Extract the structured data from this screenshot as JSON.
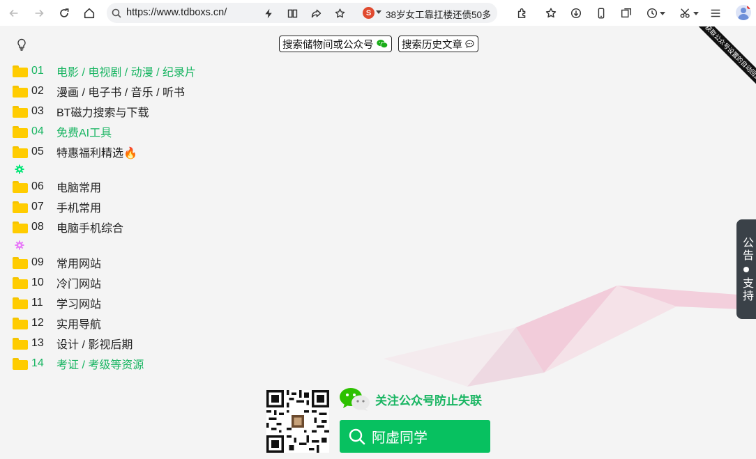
{
  "browser": {
    "url": "https://www.tdboxs.cn/",
    "news_ticker": "38岁女工靠扛楼还债50多"
  },
  "header": {
    "search_storage_label": "搜索储物间或公众号",
    "search_history_label": "搜索历史文章",
    "ribbon_text": "获取公众号设置的自动回复"
  },
  "categories": [
    {
      "num": "01",
      "label": "电影 / 电视剧 / 动漫 / 纪录片",
      "highlight": true
    },
    {
      "num": "02",
      "label": "漫画 / 电子书 / 音乐 / 听书",
      "highlight": false
    },
    {
      "num": "03",
      "label": "BT磁力搜索与下载",
      "highlight": false
    },
    {
      "num": "04",
      "label": "免费AI工具",
      "highlight": true
    },
    {
      "num": "05",
      "label": "特惠福利精选🔥",
      "highlight": false
    },
    {
      "num": "06",
      "label": "电脑常用",
      "highlight": false
    },
    {
      "num": "07",
      "label": "手机常用",
      "highlight": false
    },
    {
      "num": "08",
      "label": "电脑手机综合",
      "highlight": false
    },
    {
      "num": "09",
      "label": "常用网站",
      "highlight": false
    },
    {
      "num": "10",
      "label": "冷门网站",
      "highlight": false
    },
    {
      "num": "11",
      "label": "学习网站",
      "highlight": false
    },
    {
      "num": "12",
      "label": "实用导航",
      "highlight": false
    },
    {
      "num": "13",
      "label": "设计 / 影视后期",
      "highlight": false
    },
    {
      "num": "14",
      "label": "考证 / 考级等资源",
      "highlight": true
    }
  ],
  "separator_colors": [
    "#00e676",
    "#e879f9"
  ],
  "side_notice": {
    "top": "公告",
    "bottom": "支持"
  },
  "footer": {
    "follow_text": "关注公众号防止失联",
    "account_button": "阿虚同学"
  },
  "colors": {
    "accent_green": "#19b562",
    "button_green": "#07c160",
    "folder": "#ffcc00"
  }
}
